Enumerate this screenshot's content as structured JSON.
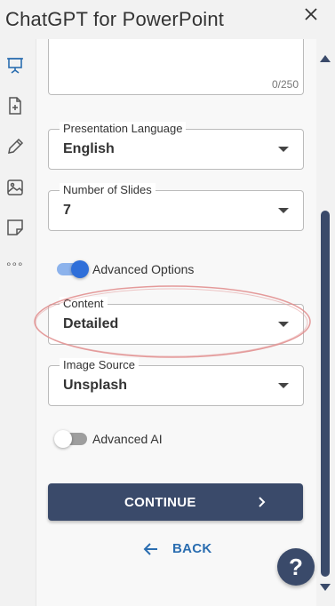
{
  "header": {
    "title": "ChatGPT for PowerPoint",
    "close_icon": "close-icon"
  },
  "rail": {
    "icons": [
      "presentation-icon",
      "document-add-icon",
      "pencil-icon",
      "image-icon",
      "sticky-note-icon",
      "more-icon"
    ],
    "active_color": "#2a6db0",
    "more_glyph": "∘∘∘"
  },
  "form": {
    "description_counter": "0/250",
    "presentation_language": {
      "label": "Presentation Language",
      "value": "English"
    },
    "number_of_slides": {
      "label": "Number of Slides",
      "value": "7"
    },
    "advanced_options": {
      "label": "Advanced Options",
      "on": true
    },
    "content": {
      "label": "Content",
      "value": "Detailed"
    },
    "image_source": {
      "label": "Image Source",
      "value": "Unsplash"
    },
    "advanced_ai": {
      "label": "Advanced AI",
      "on": false
    }
  },
  "actions": {
    "continue_label": "CONTINUE",
    "back_label": "BACK",
    "help_label": "?"
  },
  "colors": {
    "primary": "#3a4a6a",
    "link": "#2a6db0",
    "toggle_on": "#2f6fd9",
    "annotation": "#e08a8a"
  }
}
